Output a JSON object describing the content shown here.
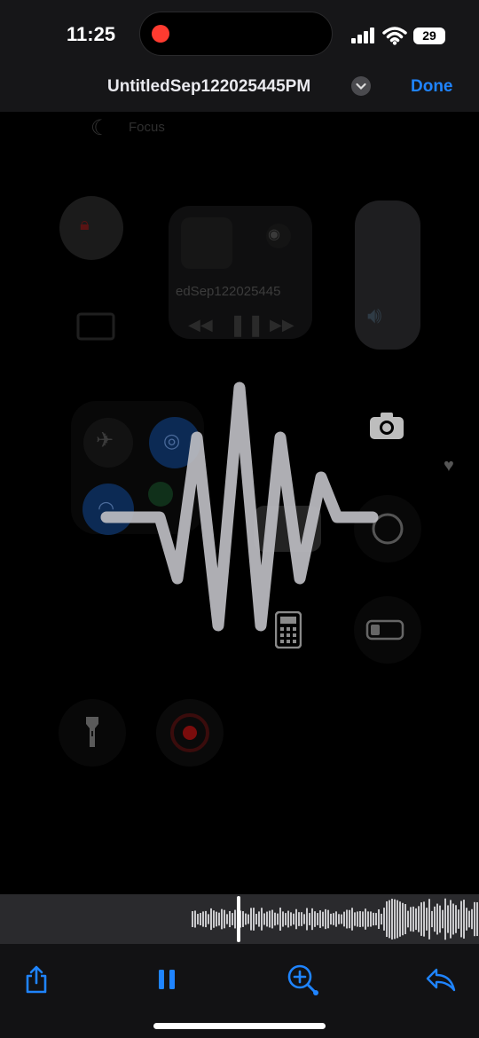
{
  "status_bar": {
    "time": "11:25",
    "battery": "29",
    "recording_color": "#ff3b30"
  },
  "header": {
    "title": "UntitledSep122025445PM",
    "done_label": "Done",
    "accent": "#1f84ff"
  },
  "preview": {
    "focus_label": "Focus",
    "media_title": "edSep122025445"
  },
  "toolbar": {
    "share_icon": "share-icon",
    "pause_icon": "pause-icon",
    "enhance_icon": "zoom-plus-icon",
    "replay_icon": "undo-arrow-icon"
  }
}
